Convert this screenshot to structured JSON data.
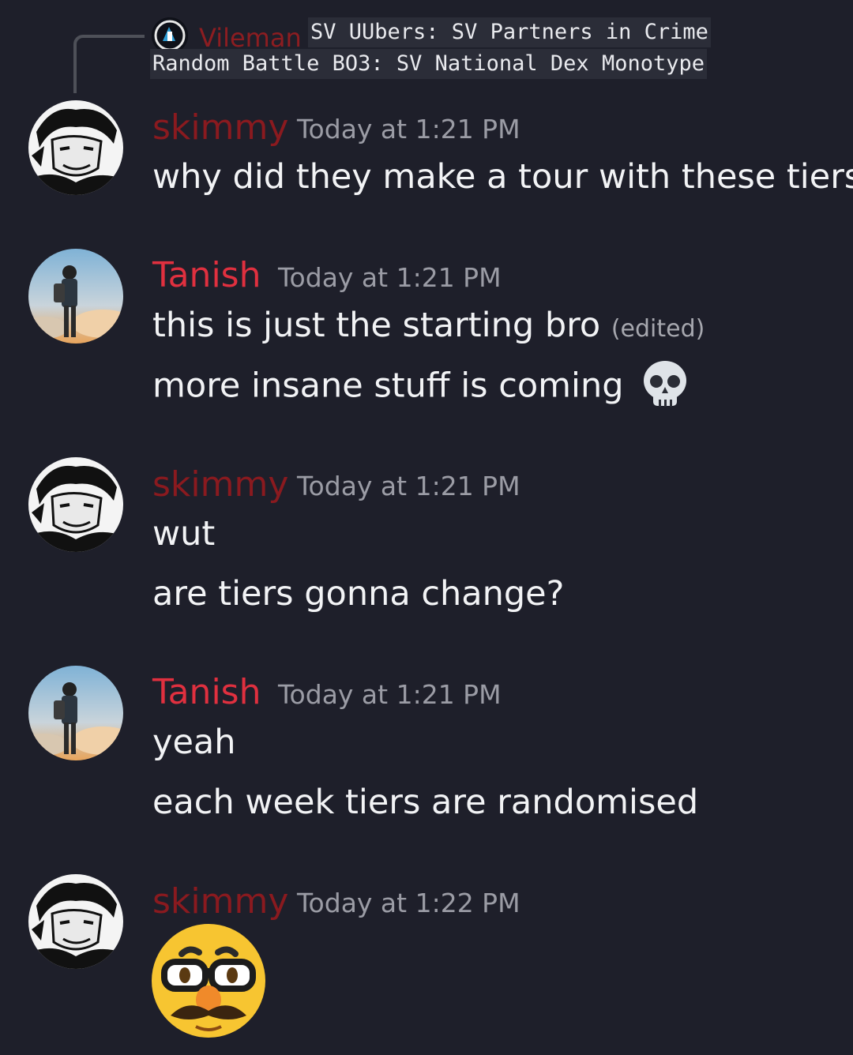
{
  "reply_preview": {
    "author": "Vileman",
    "line1": "SV UUbers: SV Partners in Crime",
    "line2": "Random Battle BO3: SV National Dex Monotype"
  },
  "messages": [
    {
      "author": "skimmy",
      "timestamp": "Today at 1:21 PM",
      "lines": [
        "why did they make a tour with these tiers"
      ]
    },
    {
      "author": "Tanish",
      "timestamp": "Today at 1:21 PM",
      "lines": [
        "this is just the starting bro",
        "more insane stuff is coming"
      ],
      "edited_label": "(edited)",
      "emoji": "skull-emoji"
    },
    {
      "author": "skimmy",
      "timestamp": "Today at 1:21 PM",
      "lines": [
        "wut",
        "are tiers gonna change?"
      ]
    },
    {
      "author": "Tanish",
      "timestamp": "Today at 1:21 PM",
      "lines": [
        "yeah",
        "each week tiers are randomised"
      ]
    },
    {
      "author": "skimmy",
      "timestamp": "Today at 1:22 PM",
      "emoji": "disguised-face-emoji"
    }
  ],
  "colors": {
    "background": "#1e1f2a",
    "skimmy_name": "#8a1a1f",
    "tanish_name": "#e0303f",
    "timestamp": "#9b9ca5",
    "message_text": "#f2f3f5"
  }
}
